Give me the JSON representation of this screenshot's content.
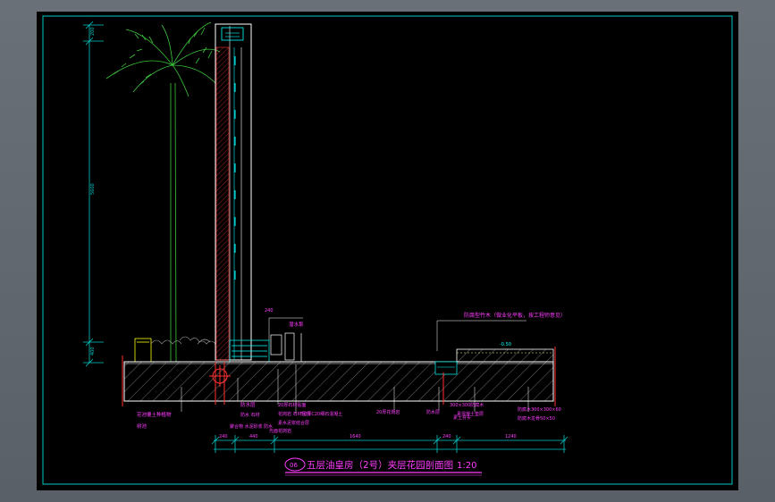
{
  "drawing": {
    "title": "五层油皇房（2号）夹层花园剖面图",
    "scale": "1:20",
    "title_badge": "06"
  },
  "colors": {
    "background": "#000000",
    "frame": "#00c8c8",
    "dim": "#00c8c8",
    "section": "#ffffff",
    "hatch": "#9a9a9a",
    "plant": "#3cc83c",
    "label": "#ff3cff",
    "pipe": "#ff3030",
    "water": "#00ffff"
  },
  "labels": {
    "top_right": "防腐型竹木（做业化平板，按工程师意见）",
    "left_1": "花池覆土种植物",
    "left_2": "树池",
    "mid_1": "防水层",
    "mid_2": "防水 石材",
    "mid_3": "聚合物 水泥砂浆 防水",
    "mid_4": "20厚石材贴面",
    "mid_5": "花岗岩 石材压顶",
    "mid_6": "素水泥浆结合层",
    "mid_7": "光面花岗岩",
    "mid_8": "50厚C20细石混凝土",
    "floor_1": "20厚花岗岩",
    "floor_2": "防水层",
    "floor_3": "素土夯实",
    "right_1": "300×300防腐木",
    "right_2": "素混凝土垫层",
    "right_3": "防腐木300×300×60",
    "right_4": "防腐木龙骨50×50",
    "pump": "潜水泵",
    "level": "-0.50"
  },
  "dimensions": {
    "v_total": "5600",
    "v_top": "200",
    "v_bot": "400",
    "h": [
      "240",
      "440",
      "1640",
      "240",
      "1240"
    ],
    "h_sub": [
      "240"
    ]
  }
}
